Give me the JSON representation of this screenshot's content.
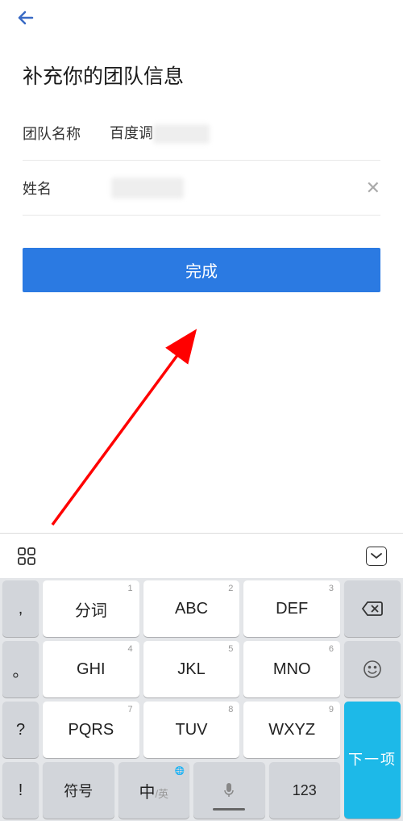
{
  "header": {},
  "pageTitle": "补充你的团队信息",
  "form": {
    "teamNameLabel": "团队名称",
    "teamNameValue": "百度调",
    "nameLabel": "姓名",
    "nameValue": ""
  },
  "submit": {
    "label": "完成"
  },
  "keyboard": {
    "leftPunct": [
      ",",
      "。",
      "?",
      "!"
    ],
    "keys": [
      {
        "num": "1",
        "main": "分词"
      },
      {
        "num": "2",
        "main": "ABC"
      },
      {
        "num": "3",
        "main": "DEF"
      },
      {
        "num": "4",
        "main": "GHI"
      },
      {
        "num": "5",
        "main": "JKL"
      },
      {
        "num": "6",
        "main": "MNO"
      },
      {
        "num": "7",
        "main": "PQRS"
      },
      {
        "num": "8",
        "main": "TUV"
      },
      {
        "num": "9",
        "main": "WXYZ"
      }
    ],
    "symbolsLabel": "符号",
    "langMain": "中",
    "langSub": "/英",
    "numbersLabel": "123",
    "nextLabel": "下一项"
  }
}
